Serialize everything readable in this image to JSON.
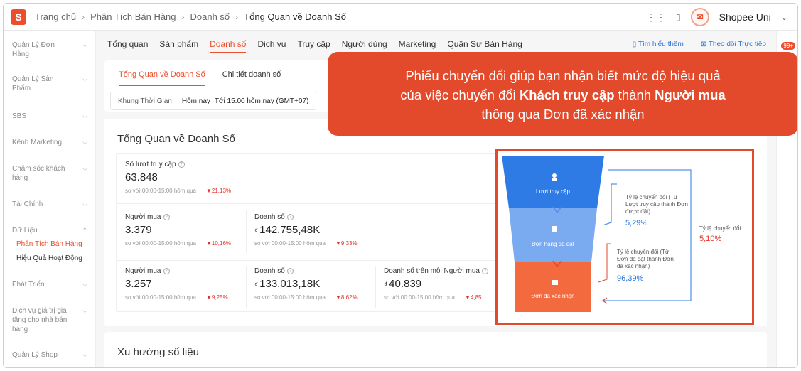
{
  "breadcrumb": [
    "Trang chủ",
    "Phân Tích Bán Hàng",
    "Doanh số",
    "Tổng Quan về Doanh Số"
  ],
  "shop_name": "Shopee Uni",
  "sidebar": {
    "items": [
      {
        "label": "Quản Lý Đơn Hàng"
      },
      {
        "label": "Quản Lý Sản Phẩm"
      },
      {
        "label": "SBS"
      },
      {
        "label": "Kênh Marketing"
      },
      {
        "label": "Chăm sóc khách hàng"
      },
      {
        "label": "Tài Chính"
      },
      {
        "label": "Dữ Liệu"
      },
      {
        "label": "Phát Triển"
      },
      {
        "label": "Dịch vụ giá trị gia tăng cho nhà bán hàng"
      },
      {
        "label": "Quản Lý Shop"
      }
    ],
    "sub_items": [
      {
        "label": "Phân Tích Bán Hàng",
        "active": true
      },
      {
        "label": "Hiệu Quả Hoạt Động",
        "active": false
      }
    ]
  },
  "notification_badge": "99+",
  "main_tabs": [
    "Tổng quan",
    "Sản phẩm",
    "Doanh số",
    "Dịch vụ",
    "Truy cập",
    "Người dùng",
    "Marketing",
    "Quân Sư Bán Hàng"
  ],
  "active_main_tab": "Doanh số",
  "right_links": {
    "learn_more": "Tìm hiểu thêm",
    "live_track": "Theo dõi Trực tiếp"
  },
  "sub_tabs": [
    "Tổng Quan về Doanh Số",
    "Chi tiết doanh số"
  ],
  "time_filter": {
    "label": "Khung Thời Gian",
    "value": "Hôm nay",
    "detail": "Tới 15.00 hôm nay (GMT+07)"
  },
  "overview_title": "Tổng Quan về Doanh Số",
  "metrics": {
    "visits": {
      "label": "Số lượt truy cập",
      "value": "63.848",
      "compare": "so với 00:00-15:00 hôm qua",
      "change": "21,13%"
    },
    "buyers_1": {
      "label": "Người mua",
      "value": "3.379",
      "compare": "so với 00:00-15:00 hôm qua",
      "change": "10,16%"
    },
    "sales_1": {
      "label": "Doanh số",
      "currency": "₫",
      "value": "142.755,48K",
      "compare": "so với 00:00-15:00 hôm qua",
      "change": "9,33%"
    },
    "buyers_2": {
      "label": "Người mua",
      "value": "3.257",
      "compare": "so với 00:00-15:00 hôm qua",
      "change": "9,25%"
    },
    "sales_2": {
      "label": "Doanh số",
      "currency": "₫",
      "value": "133.013,18K",
      "compare": "so với 00:00-15:00 hôm qua",
      "change": "8,62%"
    },
    "sales_per_buyer": {
      "label": "Doanh số trên mỗi Người mua",
      "currency": "₫",
      "value": "40.839",
      "compare": "so với 00:00-15:00 hôm qua",
      "change": "4,85"
    }
  },
  "callout": {
    "line1": "Phiếu chuyển đổi giúp bạn nhận biết mức độ hiệu quả",
    "line2_pre": "của việc chuyển đổi ",
    "line2_b1": "Khách truy cập",
    "line2_mid": " thành ",
    "line2_b2": "Người mua",
    "line3": "thông qua Đơn đã xác nhận"
  },
  "funnel": {
    "stages": [
      "Lượt truy cập",
      "Đơn hàng đã đặt",
      "Đơn đã xác nhận"
    ],
    "colors": {
      "stage1": "#2e7be6",
      "stage2": "#7aaaf0",
      "stage3": "#f26a3d",
      "accent": "#e3492b"
    },
    "rate1_label": "Tỷ lệ chuyển đổi (Từ Lượt truy cập thành Đơn được đặt)",
    "rate1_value": "5,29%",
    "rate2_label": "Tỷ lệ chuyển đổi (Từ Đơn đã đặt thành Đơn đã xác nhận)",
    "rate2_value": "96,39%",
    "total_label": "Tỷ lệ chuyển đổi",
    "total_value": "5,10%"
  },
  "trend_title": "Xu hướng số liệu"
}
